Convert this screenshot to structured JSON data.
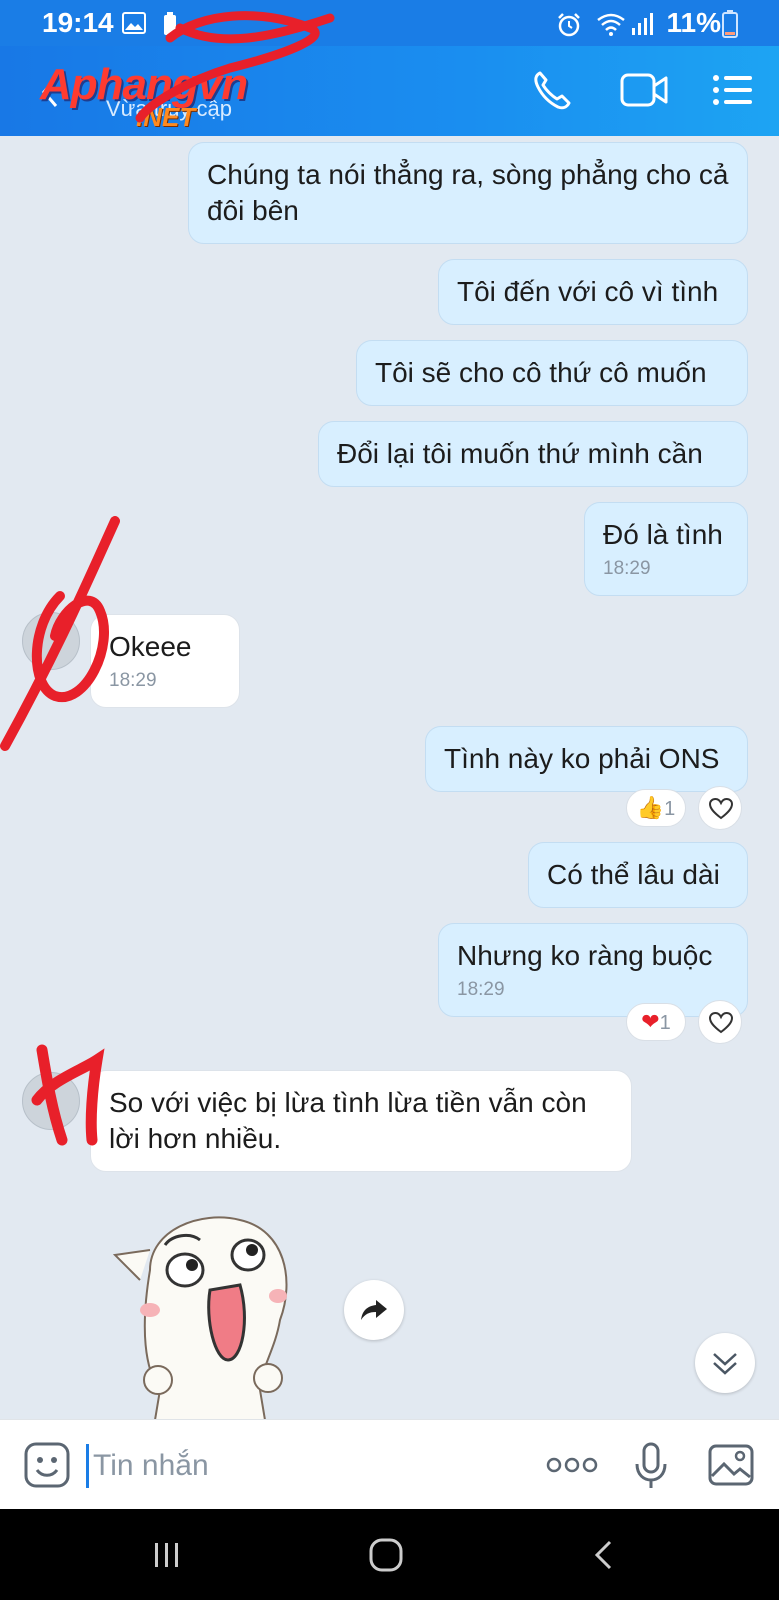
{
  "status_bar": {
    "time": "19:14",
    "battery": "11%"
  },
  "header": {
    "brand_main": "Aphangvn",
    "brand_suffix": ".NET",
    "subtitle": "Vừa truy cập"
  },
  "messages": [
    {
      "side": "mine",
      "text": "Chúng ta nói thẳng ra, sòng phẳng cho cả đôi bên"
    },
    {
      "side": "mine",
      "text": "Tôi đến với cô vì tình"
    },
    {
      "side": "mine",
      "text": "Tôi sẽ cho cô thứ cô muốn"
    },
    {
      "side": "mine",
      "text": "Đổi lại tôi muốn thứ mình cần"
    },
    {
      "side": "mine",
      "text": "Đó là tình",
      "time": "18:29"
    },
    {
      "side": "theirs",
      "text": "Okeee",
      "time": "18:29"
    },
    {
      "side": "mine",
      "text": "Tình này ko phải ONS",
      "reaction": "1"
    },
    {
      "side": "mine",
      "text": "Có thể lâu dài"
    },
    {
      "side": "mine",
      "text": "Nhưng ko ràng buộc",
      "time": "18:29",
      "reaction": "1"
    },
    {
      "side": "theirs",
      "text": "So với việc bị lừa tình lừa tiền vẫn còn lời hơn nhiều."
    }
  ],
  "input": {
    "placeholder": "Tin nhắn"
  },
  "icons": {
    "reaction_like": "thumbs-up-icon",
    "reaction_love": "red-heart-icon",
    "react_button": "heart-outline-icon"
  },
  "colors": {
    "header": "#1a7de6",
    "my_bubble": "#d8efff",
    "their_bubble": "#ffffff",
    "background": "#e2e9f1"
  }
}
